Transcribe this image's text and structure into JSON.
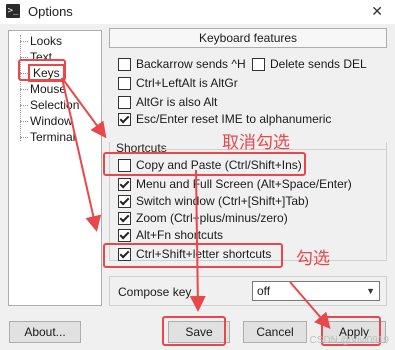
{
  "window": {
    "title": "Options",
    "icon": "terminal-icon",
    "close_glyph": "✕"
  },
  "tree": {
    "items": [
      {
        "label": "Looks",
        "selected": false
      },
      {
        "label": "Text",
        "selected": false
      },
      {
        "label": "Keys",
        "selected": true
      },
      {
        "label": "Mouse",
        "selected": false
      },
      {
        "label": "Selection",
        "selected": false
      },
      {
        "label": "Window",
        "selected": false
      },
      {
        "label": "Terminal",
        "selected": false
      }
    ]
  },
  "keyboard": {
    "header": "Keyboard features",
    "backarrow": {
      "label": "Backarrow sends ^H",
      "checked": false
    },
    "delete_del": {
      "label": "Delete sends DEL",
      "checked": false
    },
    "ctrl_leftalt": {
      "label": "Ctrl+LeftAlt is AltGr",
      "checked": false
    },
    "altgr_alt": {
      "label": "AltGr is also Alt",
      "checked": false
    },
    "esc_enter": {
      "label": "Esc/Enter reset IME to alphanumeric",
      "checked": true
    }
  },
  "shortcuts": {
    "label": "Shortcuts",
    "items": [
      {
        "label": "Copy and Paste (Ctrl/Shift+Ins)",
        "checked": false
      },
      {
        "label": "Menu and Full Screen (Alt+Space/Enter)",
        "checked": true
      },
      {
        "label": "Switch window (Ctrl+[Shift+]Tab)",
        "checked": true
      },
      {
        "label": "Zoom (Ctrl+plus/minus/zero)",
        "checked": true
      },
      {
        "label": "Alt+Fn shortcuts",
        "checked": true
      },
      {
        "label": "Ctrl+Shift+letter shortcuts",
        "checked": true
      }
    ]
  },
  "annotations": {
    "uncheck": "取消勾选",
    "check": "勾选",
    "color": "#e8484c"
  },
  "compose": {
    "label": "Compose key",
    "value": "off"
  },
  "buttons": {
    "about": "About...",
    "save": "Save",
    "cancel": "Cancel",
    "apply": "Apply"
  },
  "watermark": "CSDN @Vivi0919"
}
